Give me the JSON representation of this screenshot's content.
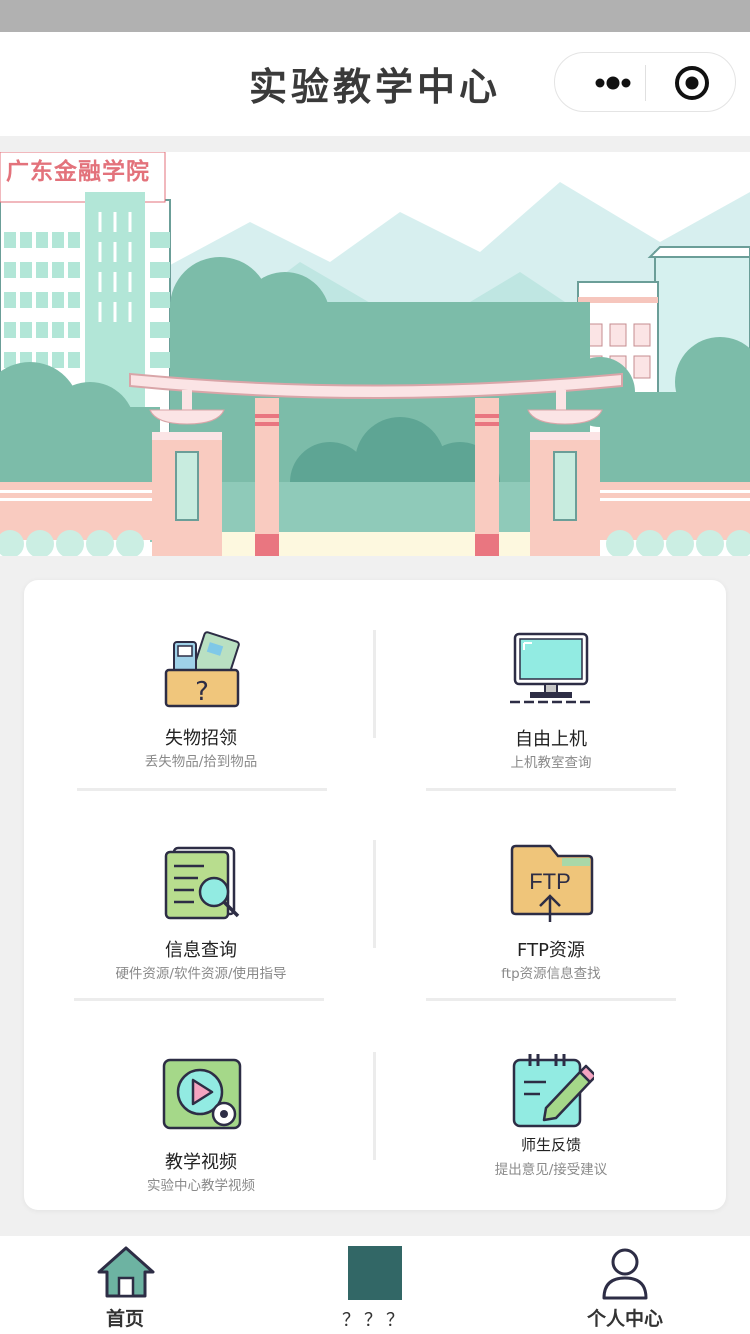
{
  "nav": {
    "title": "实验教学中心",
    "more_icon": "more-dots-icon",
    "close_icon": "target-icon"
  },
  "banner": {
    "school_name": "广东金融学院"
  },
  "menu": {
    "items": [
      {
        "label": "失物招领",
        "sub": "丢失物品/拾到物品",
        "icon": "lost-box-icon"
      },
      {
        "label": "自由上机",
        "sub": "上机教室查询",
        "icon": "monitor-icon"
      },
      {
        "label": "信息查询",
        "sub": "硬件资源/软件资源/使用指导",
        "icon": "document-search-icon"
      },
      {
        "label": "FTP资源",
        "sub": "ftp资源信息查找",
        "icon": "ftp-folder-icon",
        "icon_text": "FTP"
      },
      {
        "label": "教学视频",
        "sub": "实验中心教学视频",
        "icon": "video-play-icon"
      },
      {
        "label": "师生反馈",
        "sub": "提出意见/接受建议",
        "icon": "notepad-pen-icon"
      }
    ]
  },
  "tabbar": {
    "items": [
      {
        "label": "首页",
        "icon": "home-icon"
      },
      {
        "label": "？？？",
        "icon": "square-icon",
        "color": "#326766"
      },
      {
        "label": "个人中心",
        "icon": "user-icon"
      }
    ]
  }
}
